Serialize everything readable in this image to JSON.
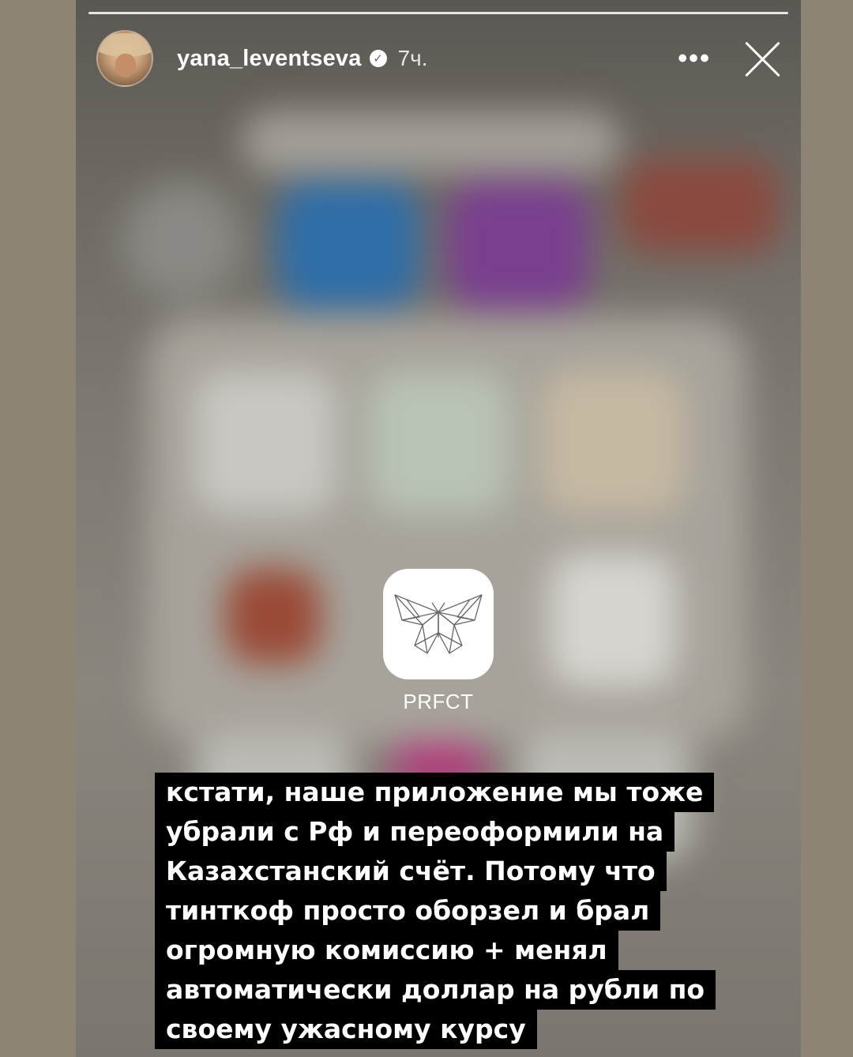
{
  "header": {
    "username": "yana_leventseva",
    "time": "7ч.",
    "more_label": "•••",
    "verified_mark": "✓"
  },
  "story": {
    "segments": 1,
    "app_label": "PRFCT",
    "caption_lines": [
      "кстати, наше приложение мы тоже",
      "убрали с Рф и переоформили на",
      "Казахстанский счёт. Потому что",
      "тинткоф просто оборзел и брал",
      "огромную комиссию + менял",
      "автоматически доллар на рубли по",
      "своему ужасному курсу"
    ]
  },
  "colors": {
    "caption_bg": "#000000",
    "caption_text": "#ffffff",
    "page_bg": "#8e8476"
  },
  "icons": [
    "butterfly-icon",
    "verified-icon",
    "more-icon",
    "close-icon",
    "avatar"
  ]
}
